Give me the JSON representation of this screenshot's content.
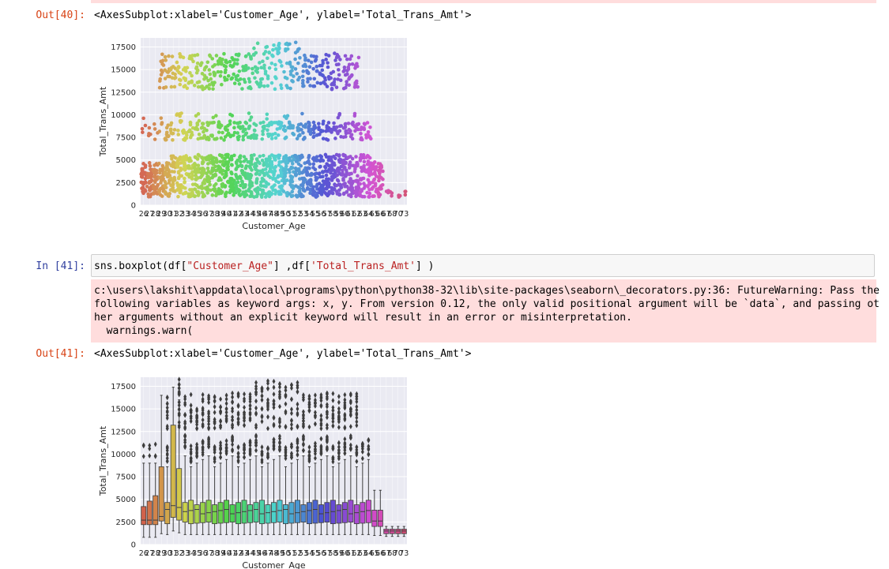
{
  "cells": [
    {
      "out_prompt": "Out[40]:",
      "out_text": "<AxesSubplot:xlabel='Customer_Age', ylabel='Total_Trans_Amt'>"
    },
    {
      "in_prompt": "In [41]:",
      "code_prefix": "sns.boxplot(df[",
      "code_str1": "\"Customer_Age\"",
      "code_mid": "] ,df[",
      "code_str2": "'Total_Trans_Amt'",
      "code_suffix": "] )",
      "warning_lines": [
        "c:\\users\\lakshit\\appdata\\local\\programs\\python\\python38-32\\lib\\site-packages\\seaborn\\_decorators.py:36: FutureWarning: Pass the",
        "following variables as keyword args: x, y. From version 0.12, the only valid positional argument will be `data`, and passing ot",
        "her arguments without an explicit keyword will result in an error or misinterpretation.",
        "  warnings.warn("
      ],
      "out_prompt": "Out[41]:",
      "out_text": "<AxesSubplot:xlabel='Customer_Age', ylabel='Total_Trans_Amt'>"
    }
  ],
  "chart_data": [
    {
      "type": "scatter",
      "style": "stripplot",
      "xlabel": "Customer_Age",
      "ylabel": "Total_Trans_Amt",
      "x": [
        26,
        27,
        28,
        29,
        30,
        31,
        32,
        33,
        34,
        35,
        36,
        37,
        38,
        39,
        40,
        41,
        42,
        43,
        44,
        45,
        46,
        47,
        48,
        49,
        50,
        51,
        52,
        53,
        54,
        55,
        56,
        57,
        58,
        59,
        60,
        61,
        62,
        63,
        64,
        65,
        66,
        67,
        68,
        70,
        73
      ],
      "tick_labels": [
        "26",
        "27",
        "28",
        "29",
        "30",
        "31",
        "32",
        "33",
        "34",
        "35",
        "36",
        "37",
        "38",
        "39",
        "40",
        "41",
        "42",
        "43",
        "44",
        "45",
        "46",
        "47",
        "48",
        "49",
        "50",
        "51",
        "52",
        "53",
        "54",
        "55",
        "56",
        "57",
        "58",
        "59",
        "60",
        "61",
        "62",
        "63",
        "64",
        "65",
        "66",
        "67",
        "68",
        "70",
        "73"
      ],
      "yticks": [
        0,
        2500,
        5000,
        7500,
        10000,
        12500,
        15000,
        17500
      ],
      "ylim": [
        0,
        18500
      ],
      "grid": true
    },
    {
      "type": "box",
      "xlabel": "Customer_Age",
      "ylabel": "Total_Trans_Amt",
      "x": [
        26,
        27,
        28,
        29,
        30,
        31,
        32,
        33,
        34,
        35,
        36,
        37,
        38,
        39,
        40,
        41,
        42,
        43,
        44,
        45,
        46,
        47,
        48,
        49,
        50,
        51,
        52,
        53,
        54,
        55,
        56,
        57,
        58,
        59,
        60,
        61,
        62,
        63,
        64,
        65,
        66,
        67,
        68,
        70,
        73
      ],
      "tick_labels": [
        "26",
        "27",
        "28",
        "29",
        "30",
        "31",
        "32",
        "33",
        "34",
        "35",
        "36",
        "37",
        "38",
        "39",
        "40",
        "41",
        "42",
        "43",
        "44",
        "45",
        "46",
        "47",
        "48",
        "49",
        "50",
        "51",
        "52",
        "53",
        "54",
        "55",
        "56",
        "57",
        "58",
        "59",
        "60",
        "61",
        "62",
        "63",
        "64",
        "65",
        "66",
        "67",
        "68",
        "70",
        "73"
      ],
      "yticks": [
        0,
        2500,
        5000,
        7500,
        10000,
        12500,
        15000,
        17500
      ],
      "ylim": [
        0,
        18500
      ],
      "grid": true
    }
  ]
}
